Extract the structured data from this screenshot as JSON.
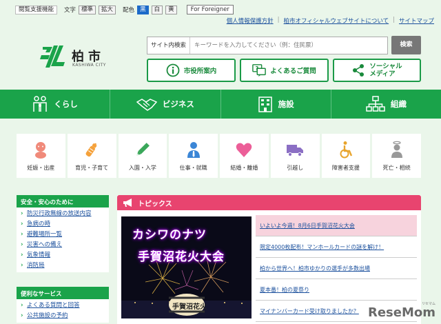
{
  "accessibility": {
    "label": "閲覧支援機能",
    "text_label": "文字",
    "text_buttons": [
      "標準",
      "拡大"
    ],
    "color_label": "配色",
    "color_buttons": [
      "黒",
      "白",
      "黄"
    ],
    "foreigner": "For Foreigner"
  },
  "toplinks": [
    "個人情報保護方針",
    "柏市オフィシャルウェブサイトについて",
    "サイトマップ"
  ],
  "logo": {
    "name": "柏市",
    "sub": "KASHIWA CITY"
  },
  "search": {
    "label": "サイト内検索",
    "placeholder": "キーワードを入力してください（例：住民票）",
    "button": "検索"
  },
  "quick": {
    "guide": "市役所案内",
    "faq": "よくあるご質問",
    "social_1": "ソーシャル",
    "social_2": "メディア"
  },
  "nav": [
    "くらし",
    "ビジネス",
    "施設",
    "組織"
  ],
  "categories": [
    "妊娠・出産",
    "育児・子育て",
    "入園・入学",
    "仕事・就職",
    "結婚・離婚",
    "引越し",
    "障害者支援",
    "死亡・相続"
  ],
  "side1": {
    "title": "安全・安心のために",
    "items": [
      "防災行政無線の放送内容",
      "急病の時",
      "避難場所一覧",
      "災害への備え",
      "気象情報",
      "消防局"
    ]
  },
  "side2": {
    "title": "便利なサービス",
    "items": [
      "よくある質問と回答",
      "公共施設の予約"
    ]
  },
  "topics": {
    "title": "トピックス",
    "banner_line1": "カシワのナツ",
    "banner_line2": "手賀沼花火大会",
    "banner_lantern": "手賀沼花火",
    "items": [
      "いよいよ今週！8月6日手賀沼花火大会",
      "限定4000枚配布！マンホールカードの謎を解け！",
      "柏から世界へ！柏市ゆかりの選手が多数出場",
      "夏本番！柏の夏祭り",
      "マイナンバーカード受け取りましたか？"
    ]
  },
  "watermark": {
    "text": "ReseMom",
    "sub": "リセマム"
  },
  "colors": {
    "green": "#1aa34a",
    "pink": "#e8446f",
    "link": "#1a4f9c"
  }
}
